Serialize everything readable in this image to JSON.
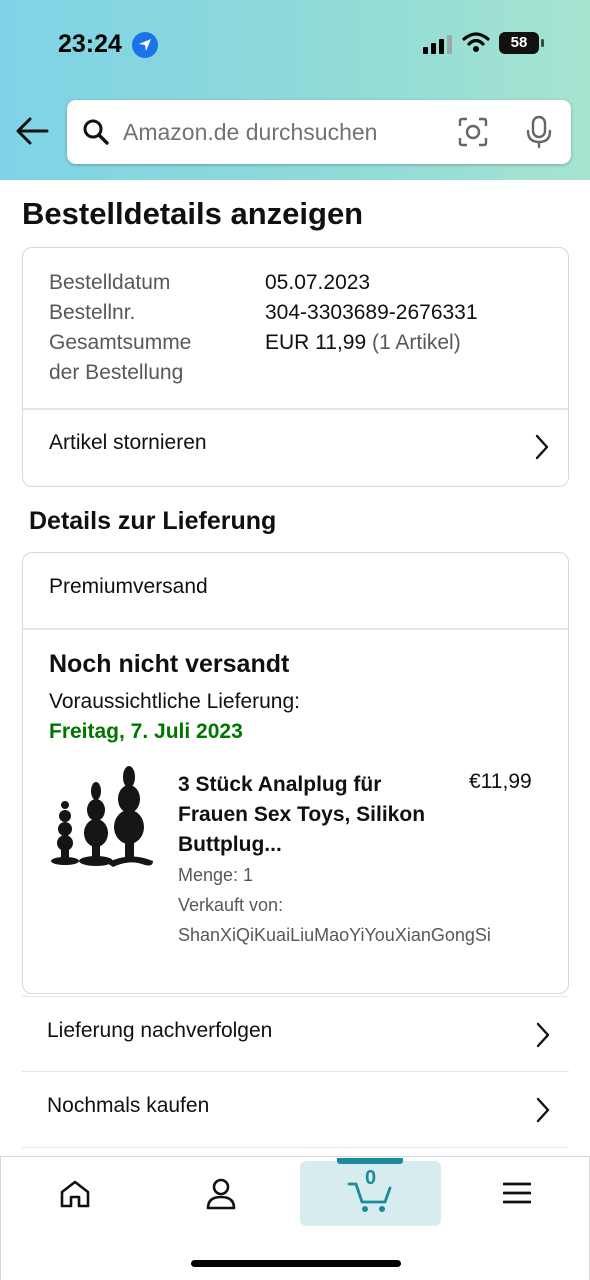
{
  "status_bar": {
    "time": "23:24",
    "battery": "58"
  },
  "search": {
    "placeholder": "Amazon.de durchsuchen"
  },
  "page_title": "Bestelldetails anzeigen",
  "order": {
    "date_label": "Bestelldatum",
    "date_value": "05.07.2023",
    "number_label": "Bestellnr.",
    "number_value": "304-3303689-2676331",
    "total_label_line1": "Gesamtsumme",
    "total_label_line2": "der Bestellung",
    "total_value": "EUR 11,99",
    "total_items": "(1 Artikel)",
    "cancel_label": "Artikel stornieren"
  },
  "delivery": {
    "section_title": "Details zur Lieferung",
    "shipping_method": "Premiumversand",
    "status": "Noch nicht versandt",
    "eta_label": "Voraussichtliche Lieferung:",
    "eta_date": "Freitag, 7. Juli 2023",
    "product": {
      "title": "3 Stück Analplug für Frauen Sex Toys, Silikon Buttplug...",
      "price": "€11,99",
      "quantity": "Menge: 1",
      "sold_by_label": "Verkauft von:",
      "seller": "ShanXiQiKuaiLiuMaoYiYouXianGongSi"
    }
  },
  "actions": {
    "track": "Lieferung nachverfolgen",
    "buy_again": "Nochmals kaufen"
  },
  "tabbar": {
    "cart_count": "0"
  },
  "colors": {
    "accent_teal": "#1b8a99",
    "delivery_green": "#007600"
  }
}
